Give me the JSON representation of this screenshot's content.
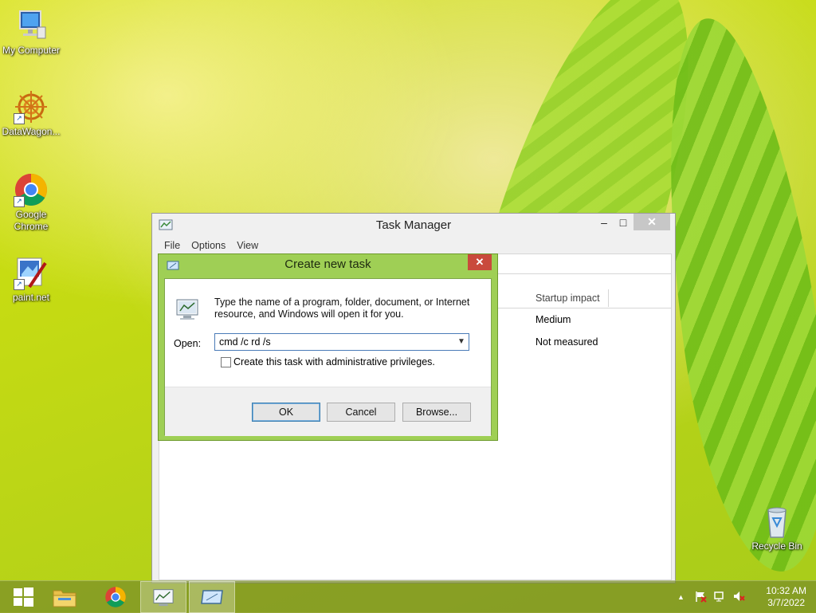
{
  "desktop": {
    "icons": [
      {
        "label": "My Computer",
        "icon": "computer-icon"
      },
      {
        "label": "DataWagon...",
        "icon": "datawagon-icon"
      },
      {
        "label": "Google Chrome",
        "icon": "chrome-icon"
      },
      {
        "label": "paint.net",
        "icon": "paintnet-icon"
      },
      {
        "label": "Recycle Bin",
        "icon": "recycle-bin-icon"
      }
    ]
  },
  "task_manager": {
    "title": "Task Manager",
    "menu": [
      "File",
      "Options",
      "View"
    ],
    "column_header": "Startup impact",
    "rows": [
      "Medium",
      "Not measured"
    ]
  },
  "run_dialog": {
    "title": "Create new task",
    "description": "Type the name of a program, folder, document, or Internet resource, and Windows will open it for you.",
    "open_label": "Open:",
    "open_value": "cmd /c rd /s",
    "admin_checkbox_label": "Create this task with administrative privileges.",
    "admin_checked": false,
    "ok_label": "OK",
    "cancel_label": "Cancel",
    "browse_label": "Browse..."
  },
  "taskbar": {
    "clock_time": "10:32 AM",
    "clock_date": "3/7/2022"
  },
  "colors": {
    "dialog_frame": "#9fcf55",
    "close_red": "#c94a3c",
    "taskbar": "#788c28"
  }
}
